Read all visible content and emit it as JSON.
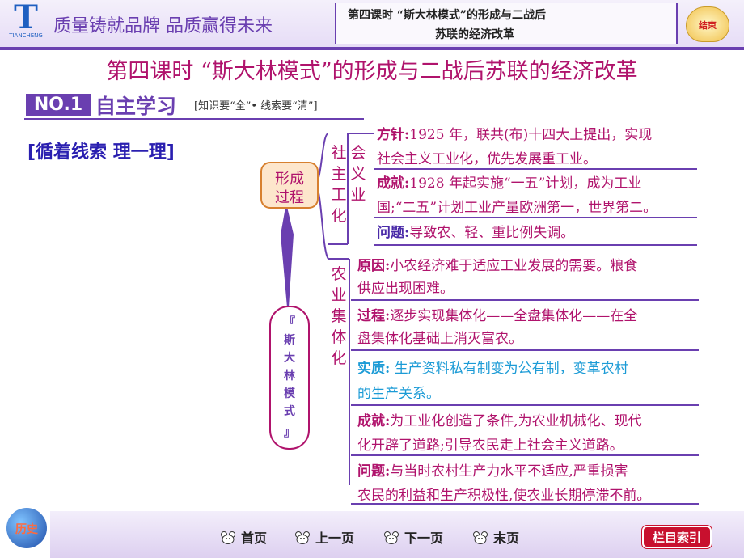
{
  "header": {
    "logo_letter": "T",
    "logo_text": "TIANCHENG",
    "slogan": "质量铸就品牌  品质赢得未来",
    "lesson_line1": "第四课时    “斯大林模式”的形成与二战后",
    "lesson_line2": "苏联的经济改革",
    "end_button": "结束"
  },
  "title": "第四课时    “斯大林模式”的形成与二战后苏联的经济改革",
  "section": {
    "badge": "NO.1",
    "name": "自主学习",
    "note": "[知识要“全”• 线索要“清”]"
  },
  "subtitle": "[循着线索 理一理]",
  "mindmap": {
    "root": [
      "『",
      "斯",
      "大",
      "林",
      "模",
      "式",
      "』"
    ],
    "formation": [
      "形成",
      "过程"
    ],
    "industrialization": [
      "社",
      "会",
      "主",
      "义",
      "工",
      "业",
      "化"
    ],
    "collectivization": [
      "农",
      "业",
      "集",
      "体",
      "化"
    ],
    "industrial_items": [
      {
        "key": "方针:",
        "line1": "1925 年，联共(布)十四大上提出，实现",
        "line2": "社会主义工业化，优先发展重工业。"
      },
      {
        "key": "成就:",
        "line1": "1928 年起实施“一五”计划，成为工业",
        "line2": "国;“二五”计划工业产量欧洲第一，世界第二。"
      },
      {
        "key": "问题:",
        "line1": "导致农、轻、重比例失调。"
      }
    ],
    "agri_items": [
      {
        "key": "原因:",
        "line1": "小农经济难于适应工业发展的需要。粮食",
        "line2": "供应出现困难。"
      },
      {
        "key": "过程:",
        "line1": "逐步实现集体化——全盘集体化——在全",
        "line2": "盘集体化基础上消灭富农。"
      },
      {
        "key": "实质:",
        "line1": " 生产资料私有制变为公有制，变革农村",
        "line2": "的生产关系。"
      },
      {
        "key": "成就:",
        "line1": "为工业化创造了条件,为农业机械化、现代",
        "line2": "化开辟了道路;引导农民走上社会主义道路。"
      },
      {
        "key": "问题:",
        "line1": "与当时农村生产力水平不适应,严重损害",
        "line2": "农民的利益和生产积极性,使农业长期停滞不前。"
      }
    ]
  },
  "footer": {
    "globe": "历史",
    "nav": [
      "首页",
      "上一页",
      "下一页",
      "末页"
    ],
    "index": "栏目索引"
  },
  "colors": {
    "accent": "#6a3fb0",
    "magenta": "#b0136c",
    "cyan": "#1c9bd6",
    "navy": "#2a1fb0"
  }
}
